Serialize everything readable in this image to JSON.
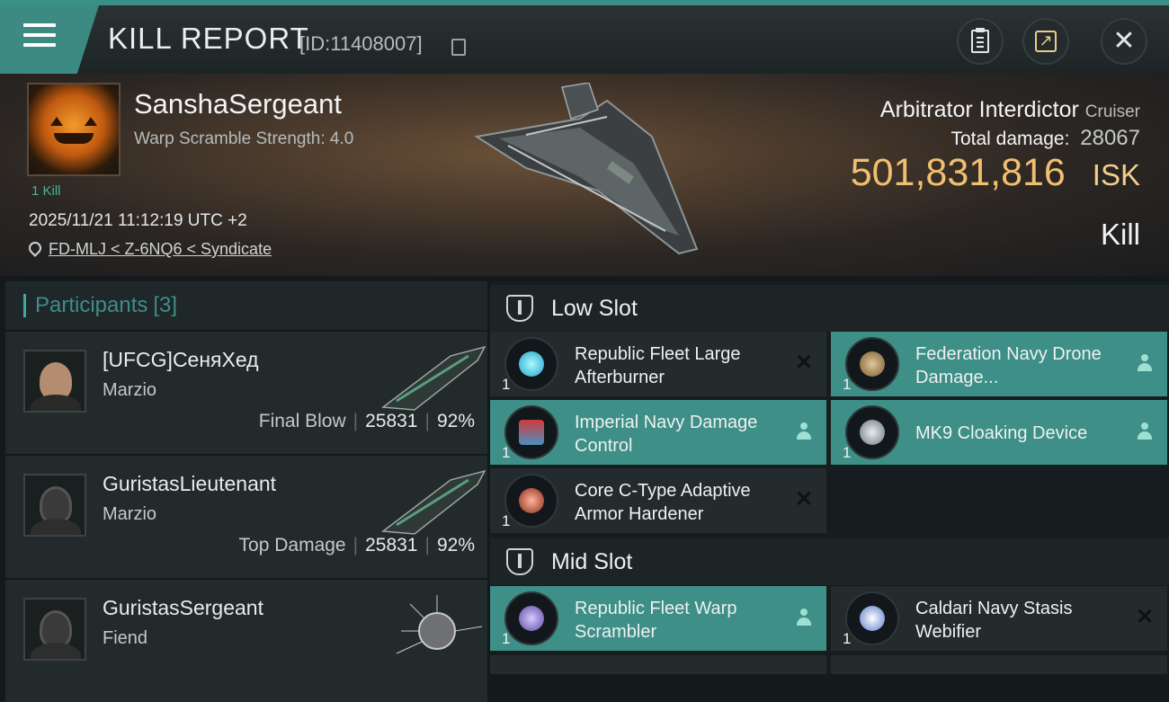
{
  "header": {
    "title": "KILL REPORT",
    "report_id": "[ID:11408007]",
    "icons": [
      "menu-icon",
      "copy-icon",
      "clipboard-icon",
      "share-icon",
      "close-icon"
    ]
  },
  "victim": {
    "name": "SanshaSergeant",
    "warp_scramble": "Warp Scramble Strength: 4.0",
    "kills": "1 Kill",
    "datetime": "2025/11/21 11:12:19 UTC +2",
    "location": "FD-MLJ < Z-6NQ6 < Syndicate",
    "ship_name": "Arbitrator Interdictor",
    "ship_class": "Cruiser",
    "damage_label": "Total damage:",
    "damage_value": "28067",
    "isk_value": "501,831,816",
    "isk_unit": "ISK",
    "status": "Kill"
  },
  "participants": {
    "title": "Participants",
    "count": "[3]",
    "list": [
      {
        "name": "[UFCG]СеняХед",
        "corp": "Marzio",
        "role": "Final Blow",
        "damage": "25831",
        "percent": "92%"
      },
      {
        "name": "GuristasLieutenant",
        "corp": "Marzio",
        "role": "Top Damage",
        "damage": "25831",
        "percent": "92%"
      },
      {
        "name": "GuristasSergeant",
        "corp": "Fiend",
        "role": "",
        "damage": "",
        "percent": ""
      }
    ]
  },
  "slots": {
    "low": {
      "label": "Low Slot",
      "modules": [
        {
          "name": "Republic Fleet Large Afterburner",
          "qty": "1",
          "state": "destroyed"
        },
        {
          "name": "Federation Navy Drone Damage...",
          "qty": "1",
          "state": "dropped"
        },
        {
          "name": "Imperial Navy Damage Control",
          "qty": "1",
          "state": "dropped"
        },
        {
          "name": "MK9 Cloaking Device",
          "qty": "1",
          "state": "dropped"
        },
        {
          "name": "Core C-Type Adaptive Armor Hardener",
          "qty": "1",
          "state": "destroyed"
        }
      ]
    },
    "mid": {
      "label": "Mid Slot",
      "modules": [
        {
          "name": "Republic Fleet Warp Scrambler",
          "qty": "1",
          "state": "dropped"
        },
        {
          "name": "Caldari Navy Stasis Webifier",
          "qty": "1",
          "state": "destroyed"
        }
      ]
    }
  },
  "colors": {
    "accent": "#3d8f87",
    "isk": "#f0c070",
    "participants_title": "#3f8d88"
  }
}
